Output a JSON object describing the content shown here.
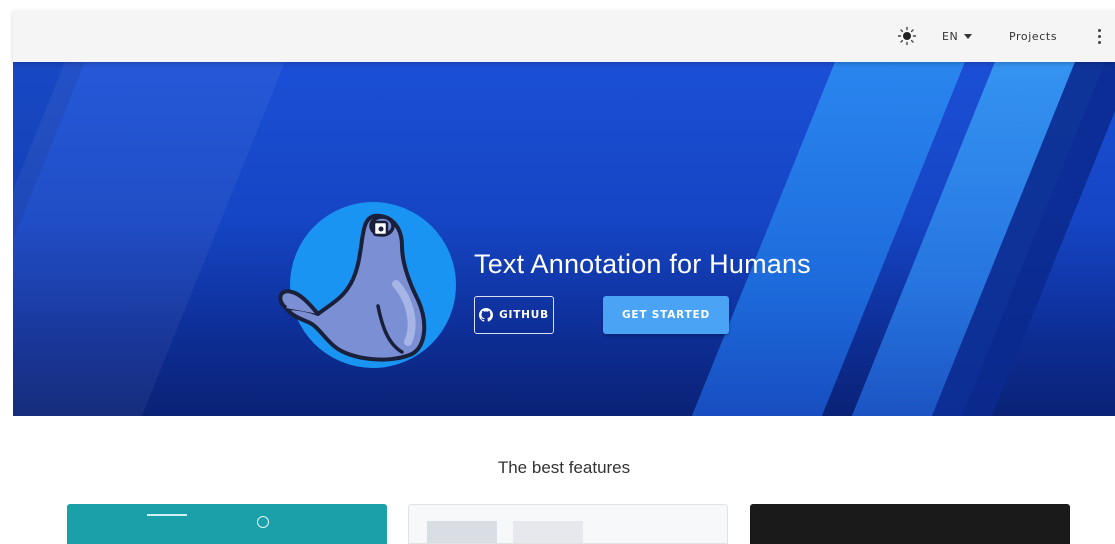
{
  "topbar": {
    "theme_icon": "sun-icon",
    "language_label": "EN",
    "projects_label": "Projects",
    "more_icon": "more-vert-icon"
  },
  "hero": {
    "logo_icon": "seal-mascot-logo",
    "title": "Text Annotation for Humans",
    "github_label": "GITHUB",
    "get_started_label": "GET STARTED"
  },
  "features": {
    "title": "The best features"
  },
  "colors": {
    "topbar_bg": "#f5f5f5",
    "hero_bg": "#1545c4",
    "logo_circle": "#1994f3",
    "primary_button": "#4aa3f5"
  }
}
